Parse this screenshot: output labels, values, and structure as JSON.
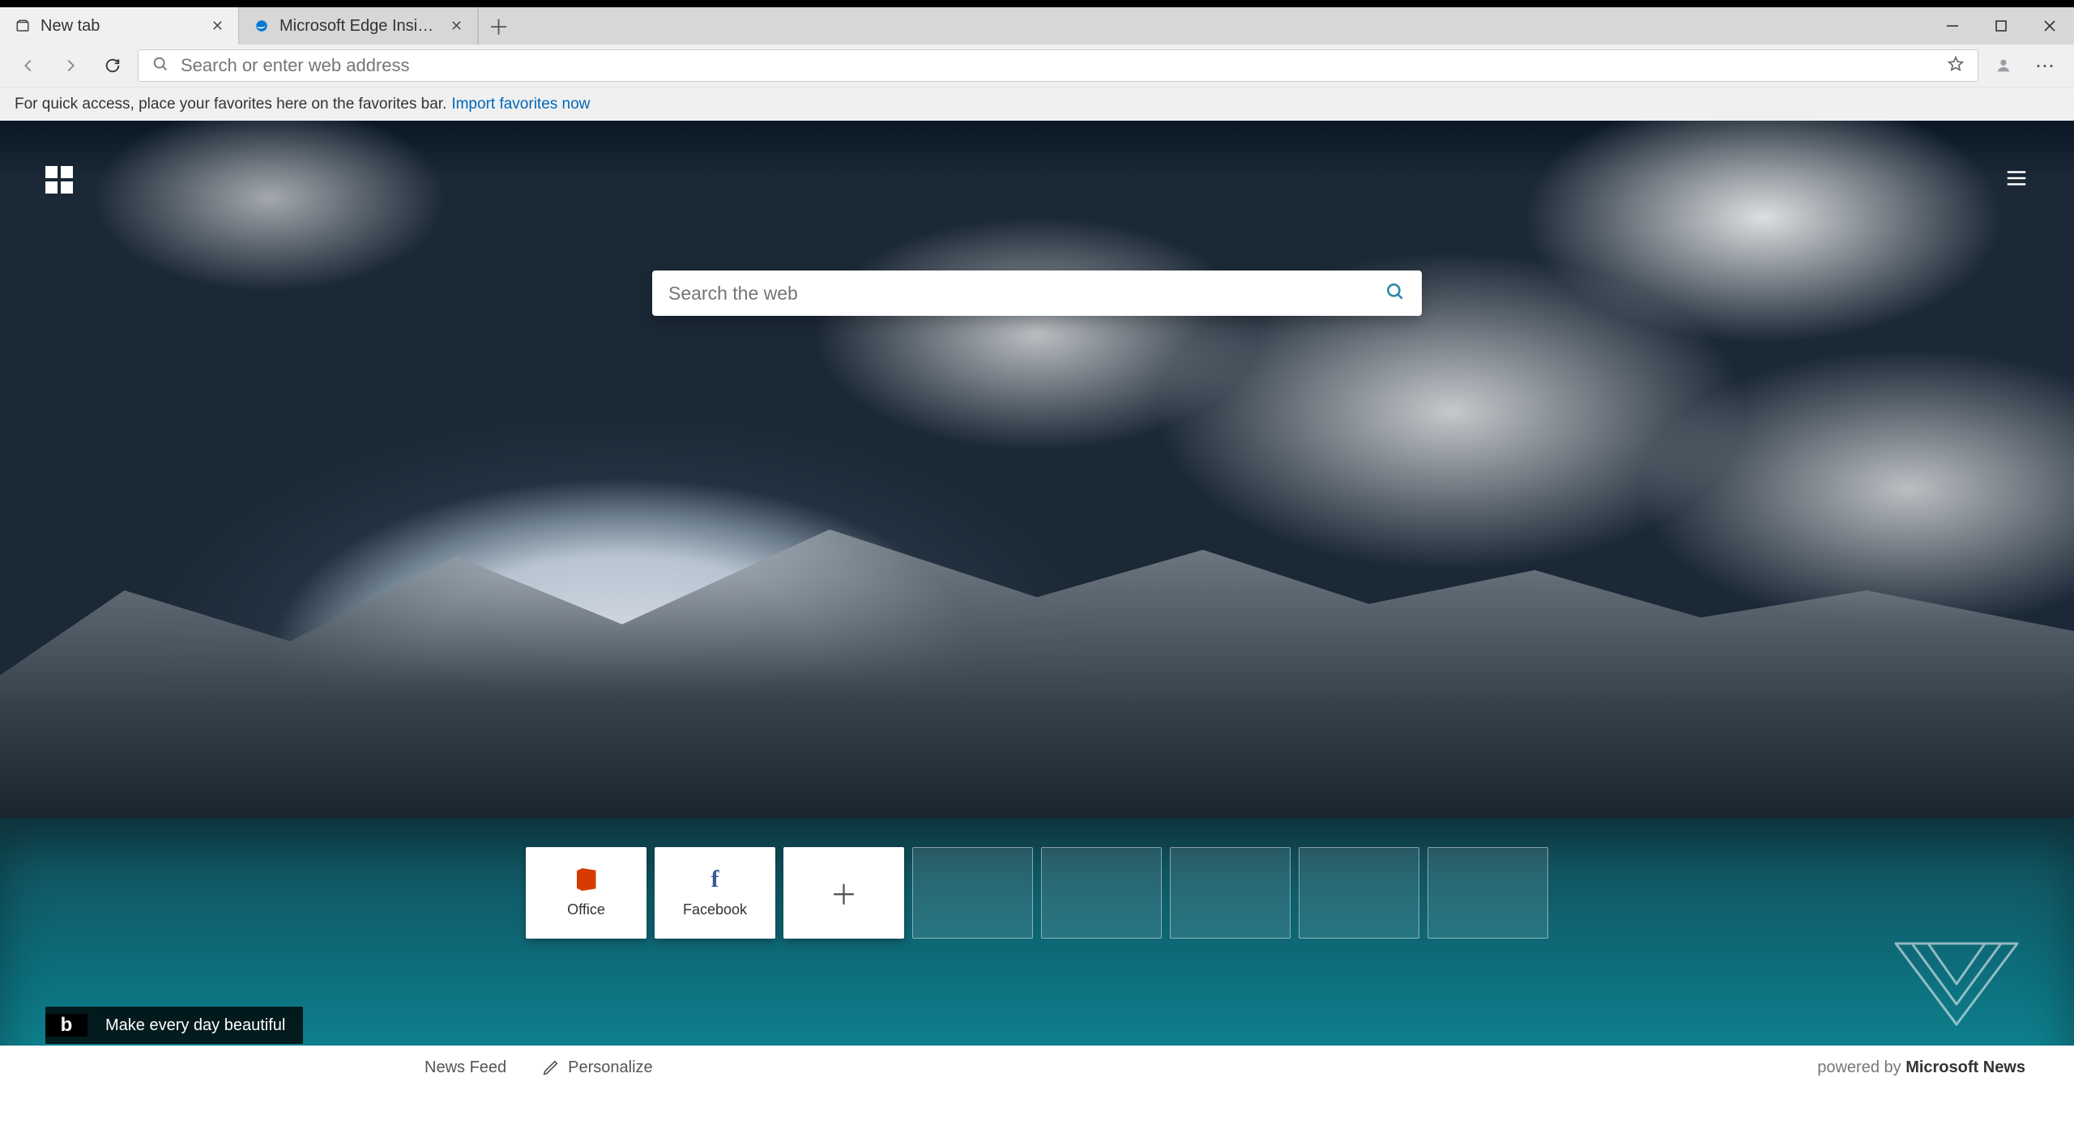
{
  "tabs": [
    {
      "title": "New tab",
      "active": true
    },
    {
      "title": "Microsoft Edge Insider",
      "active": false
    }
  ],
  "address_bar": {
    "placeholder": "Search or enter web address"
  },
  "favorites_hint": {
    "text": "For quick access, place your favorites here on the favorites bar.",
    "link": "Import favorites now"
  },
  "ntp": {
    "search_placeholder": "Search the web",
    "tiles": [
      {
        "kind": "site",
        "label": "Office",
        "icon": "office"
      },
      {
        "kind": "site",
        "label": "Facebook",
        "icon": "facebook"
      },
      {
        "kind": "add"
      },
      {
        "kind": "empty"
      },
      {
        "kind": "empty"
      },
      {
        "kind": "empty"
      },
      {
        "kind": "empty"
      },
      {
        "kind": "empty"
      }
    ],
    "bing_motto": "Make every day beautiful"
  },
  "footer": {
    "feed_label": "News Feed",
    "personalize_label": "Personalize",
    "powered_prefix": "powered by ",
    "powered_brand": "Microsoft News"
  }
}
